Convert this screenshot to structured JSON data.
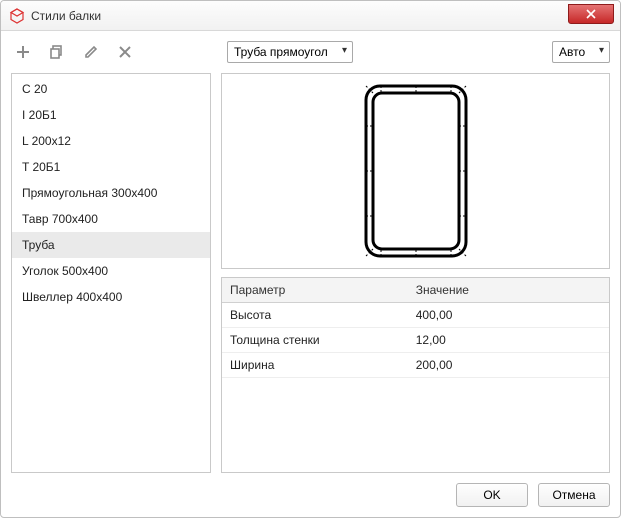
{
  "window": {
    "title": "Стили балки"
  },
  "toolbar": {
    "profile_dropdown": "Труба прямоугол",
    "zoom_dropdown": "Авто"
  },
  "styles_list": [
    {
      "label": "С 20",
      "selected": false
    },
    {
      "label": "I 20Б1",
      "selected": false
    },
    {
      "label": "L 200x12",
      "selected": false
    },
    {
      "label": "T 20Б1",
      "selected": false
    },
    {
      "label": "Прямоугольная 300x400",
      "selected": false
    },
    {
      "label": "Тавр 700x400",
      "selected": false
    },
    {
      "label": "Труба",
      "selected": true
    },
    {
      "label": "Уголок 500x400",
      "selected": false
    },
    {
      "label": "Швеллер 400x400",
      "selected": false
    }
  ],
  "params_table": {
    "headers": {
      "param": "Параметр",
      "value": "Значение"
    },
    "rows": [
      {
        "param": "Высота",
        "value": "400,00"
      },
      {
        "param": "Толщина стенки",
        "value": "12,00"
      },
      {
        "param": "Ширина",
        "value": "200,00"
      }
    ]
  },
  "footer": {
    "ok": "OK",
    "cancel": "Отмена"
  }
}
